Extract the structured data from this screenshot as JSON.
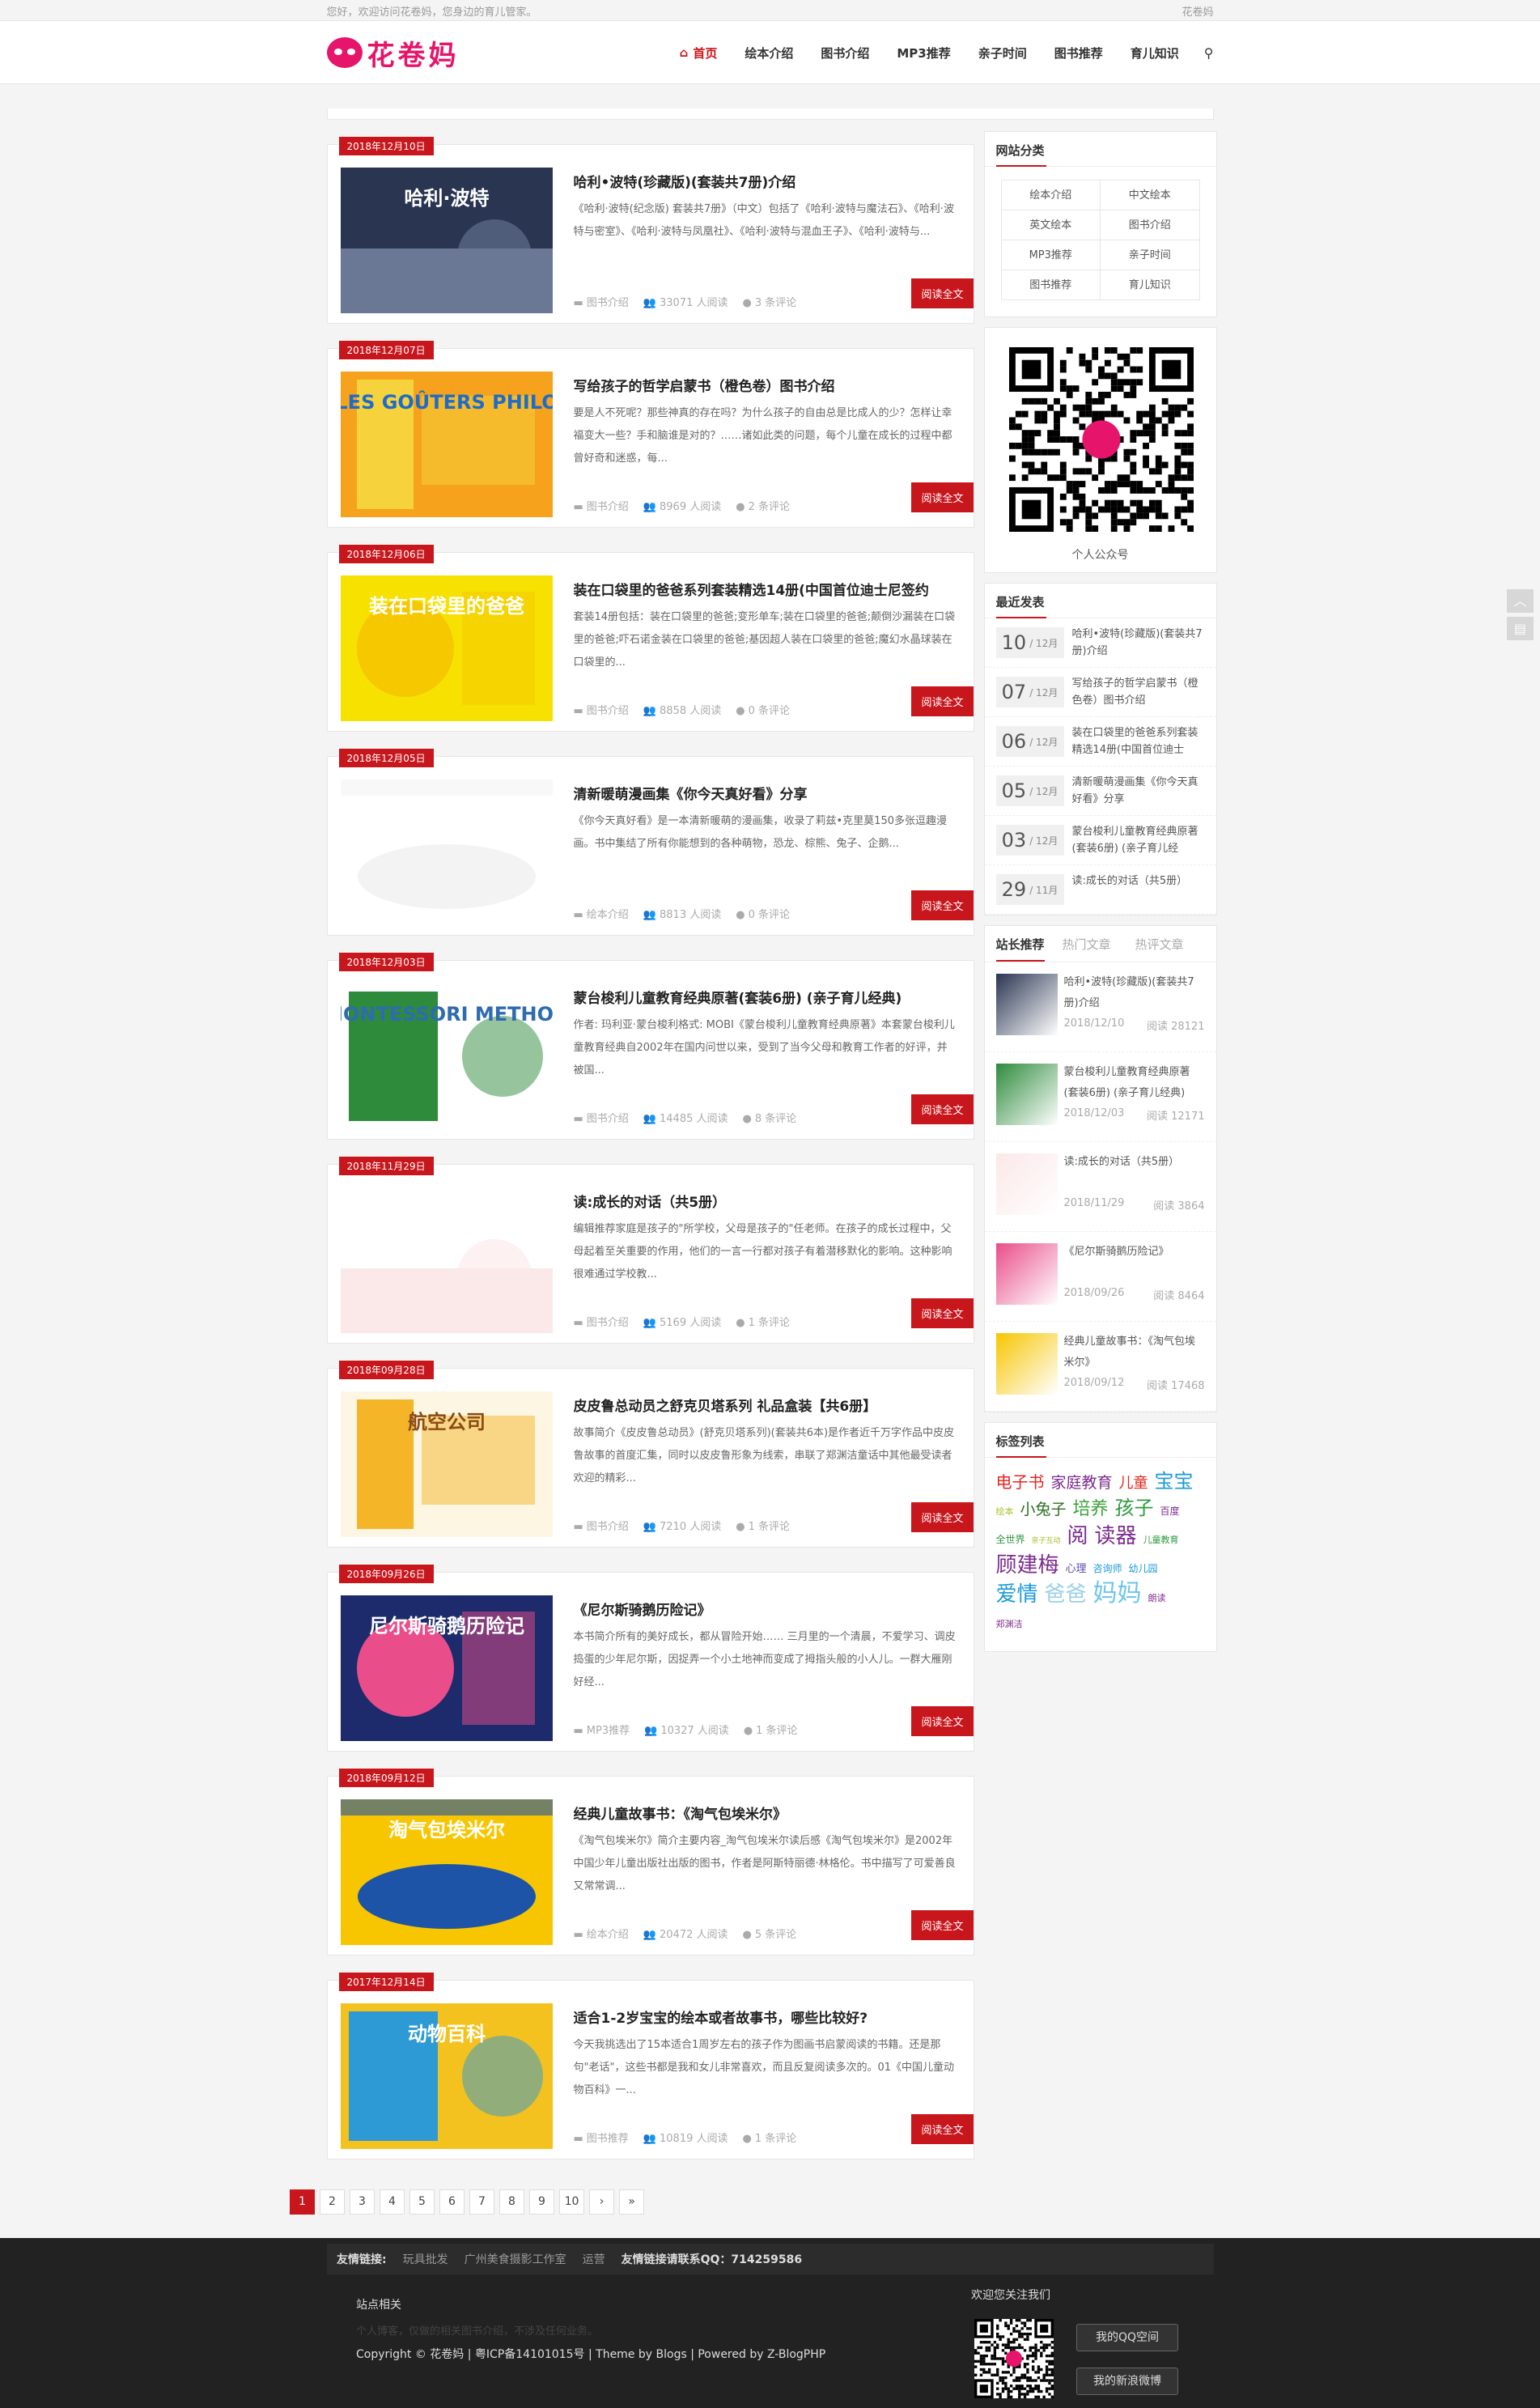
{
  "topbar": {
    "greeting": "您好，欢迎访问花卷妈，您身边的育儿管家。",
    "site": "花卷妈"
  },
  "header": {
    "logo_text": "花卷妈",
    "nav": [
      "首页",
      "绘本介绍",
      "图书介绍",
      "MP3推荐",
      "亲子时间",
      "图书推荐",
      "育儿知识"
    ]
  },
  "posts": [
    {
      "date": "2018年12月10日",
      "title": "哈利•波特(珍藏版)(套装共7册)介绍",
      "excerpt": "《哈利·波特(纪念版) 套装共7册》（中文）包括了《哈利·波特与魔法石》、《哈利·波特与密室》、《哈利·波特与凤凰社》、《哈利·波特与混血王子》、《哈利·波特与...",
      "category": "图书介绍",
      "reads": "33071 人阅读",
      "comments": "3 条评论",
      "thumb_text": "哈利·波特",
      "colors": [
        "#2a3552",
        "#6a7896"
      ]
    },
    {
      "date": "2018年12月07日",
      "title": "写给孩子的哲学启蒙书（橙色卷）图书介绍",
      "excerpt": "要是人不死呢？那些神真的存在吗？为什么孩子的自由总是比成人的少？怎样让幸福变大一些？手和脑谁是对的？……诸如此类的问题，每个儿童在成长的过程中都曾好奇和迷惑，每...",
      "category": "图书介绍",
      "reads": "8969 人阅读",
      "comments": "2 条评论",
      "thumb_text": "LES GOÛTERS PHILO",
      "colors": [
        "#f6a21c",
        "#f6d33c"
      ]
    },
    {
      "date": "2018年12月06日",
      "title": "装在口袋里的爸爸系列套装精选14册(中国首位迪士尼签约",
      "excerpt": "套装14册包括：装在口袋里的爸爸;变形单车;装在口袋里的爸爸;颠倒沙漏装在口袋里的爸爸;吓石诺金装在口袋里的爸爸;基因超人装在口袋里的爸爸;魔幻水晶球装在口袋里的...",
      "category": "图书介绍",
      "reads": "8858 人阅读",
      "comments": "0 条评论",
      "thumb_text": "装在口袋里的爸爸",
      "colors": [
        "#f7e100",
        "#f6c800"
      ]
    },
    {
      "date": "2018年12月05日",
      "title": "清新暖萌漫画集《你今天真好看》分享",
      "excerpt": "《你今天真好看》是一本清新暖萌的漫画集，收录了莉兹•克里莫150多张逗趣漫画。书中集结了所有你能想到的各种萌物，恐龙、棕熊、兔子、企鹅...",
      "category": "绘本介绍",
      "reads": "8813 人阅读",
      "comments": "0 条评论",
      "thumb_text": "",
      "colors": [
        "#ffffff",
        "#f3f3f3"
      ]
    },
    {
      "date": "2018年12月03日",
      "title": "蒙台梭利儿童教育经典原著(套装6册) (亲子育儿经典)",
      "excerpt": "作者: 玛利亚·蒙台梭利格式: MOBI《蒙台梭利儿童教育经典原著》本套蒙台梭利儿童教育经典自2002年在国内问世以来，受到了当今父母和教育工作者的好评，并被国...",
      "category": "图书介绍",
      "reads": "14485 人阅读",
      "comments": "8 条评论",
      "thumb_text": "MONTESSORI METHOD",
      "colors": [
        "#ffffff",
        "#2e8b3c"
      ]
    },
    {
      "date": "2018年11月29日",
      "title": "读:成长的对话（共5册）",
      "excerpt": "编辑推荐家庭是孩子的\"所学校，父母是孩子的\"任老师。在孩子的成长过程中，父母起着至关重要的作用，他们的一言一行都对孩子有着潜移默化的影响。这种影响很难通过学校教...",
      "category": "图书介绍",
      "reads": "5169 人阅读",
      "comments": "1 条评论",
      "thumb_text": "",
      "colors": [
        "#ffffff",
        "#fbe8e8"
      ]
    },
    {
      "date": "2018年09月28日",
      "title": "皮皮鲁总动员之舒克贝塔系列 礼品盒装【共6册】",
      "excerpt": "故事简介《皮皮鲁总动员》(舒克贝塔系列)(套装共6本)是作者近千万字作品中皮皮鲁故事的首度汇集，同时以皮皮鲁形象为线索，串联了郑渊洁童话中其他最受读者欢迎的精彩...",
      "category": "图书介绍",
      "reads": "7210 人阅读",
      "comments": "1 条评论",
      "thumb_text": "航空公司",
      "colors": [
        "#fdf6e3",
        "#f4b528"
      ]
    },
    {
      "date": "2018年09月26日",
      "title": "《尼尔斯骑鹅历险记》",
      "excerpt": "本书简介所有的美好成长，都从冒险开始…… 三月里的一个清晨，不爱学习、调皮捣蛋的少年尼尔斯，因捉弄一个小土地神而变成了拇指头般的小人儿。一群大雁刚好经...",
      "category": "MP3推荐",
      "reads": "10327 人阅读",
      "comments": "1 条评论",
      "thumb_text": "尼尔斯骑鹅历险记",
      "colors": [
        "#1d2a6b",
        "#e94d8a"
      ]
    },
    {
      "date": "2018年09月12日",
      "title": "经典儿童故事书：《淘气包埃米尔》",
      "excerpt": "《淘气包埃米尔》简介主要内容_淘气包埃米尔读后感《淘气包埃米尔》是2002年中国少年儿童出版社出版的图书，作者是阿斯特丽德·林格伦。书中描写了可爱善良又常常调...",
      "category": "绘本介绍",
      "reads": "20472 人阅读",
      "comments": "5 条评论",
      "thumb_text": "淘气包埃米尔",
      "colors": [
        "#f7c600",
        "#1d54a8"
      ]
    },
    {
      "date": "2017年12月14日",
      "title": "适合1-2岁宝宝的绘本或者故事书，哪些比较好?",
      "excerpt": "今天我挑选出了15本适合1周岁左右的孩子作为图画书启蒙阅读的书籍。还是那句\"老话\"，这些书都是我和女儿非常喜欢，而且反复阅读多次的。01《中国儿童动物百科》一...",
      "category": "图书推荐",
      "reads": "10819 人阅读",
      "comments": "1 条评论",
      "thumb_text": "动物百科",
      "colors": [
        "#f4c21e",
        "#2d9ad6"
      ]
    }
  ],
  "post_readmore": "阅读全文",
  "pagination": [
    "1",
    "2",
    "3",
    "4",
    "5",
    "6",
    "7",
    "8",
    "9",
    "10",
    "›",
    "»"
  ],
  "sidebar": {
    "categories_title": "网站分类",
    "categories": [
      "绘本介绍",
      "中文绘本",
      "英文绘本",
      "图书介绍",
      "MP3推荐",
      "亲子时间",
      "图书推荐",
      "育儿知识"
    ],
    "qr_caption": "个人公众号",
    "recent_title": "最近发表",
    "recent": [
      {
        "day": "10",
        "month": "/ 12月",
        "title": "哈利•波特(珍藏版)(套装共7册)介绍"
      },
      {
        "day": "07",
        "month": "/ 12月",
        "title": "写给孩子的哲学启蒙书（橙色卷）图书介绍"
      },
      {
        "day": "06",
        "month": "/ 12月",
        "title": "装在口袋里的爸爸系列套装精选14册(中国首位迪士"
      },
      {
        "day": "05",
        "month": "/ 12月",
        "title": "清新暖萌漫画集《你今天真好看》分享"
      },
      {
        "day": "03",
        "month": "/ 12月",
        "title": "蒙台梭利儿童教育经典原著(套装6册) (亲子育儿经"
      },
      {
        "day": "29",
        "month": "/ 11月",
        "title": "读:成长的对话（共5册）"
      }
    ],
    "tabs": [
      "站长推荐",
      "热门文章",
      "热评文章"
    ],
    "hot": [
      {
        "title": "哈利•波特(珍藏版)(套装共7册)介绍",
        "date": "2018/12/10",
        "views": "阅读 28121"
      },
      {
        "title": "蒙台梭利儿童教育经典原著(套装6册) (亲子育儿经典)",
        "date": "2018/12/03",
        "views": "阅读 12171"
      },
      {
        "title": "读:成长的对话（共5册）",
        "date": "2018/11/29",
        "views": "阅读 3864"
      },
      {
        "title": "《尼尔斯骑鹅历险记》",
        "date": "2018/09/26",
        "views": "阅读 8464"
      },
      {
        "title": "经典儿童故事书：《淘气包埃米尔》",
        "date": "2018/09/12",
        "views": "阅读 17468"
      }
    ],
    "tags_title": "标签列表",
    "tags": [
      {
        "t": "电子书",
        "c": "#e2261f",
        "s": 20
      },
      {
        "t": "家庭教育",
        "c": "#7b2b8e",
        "s": 19
      },
      {
        "t": "儿童",
        "c": "#e2261f",
        "s": 18
      },
      {
        "t": "宝宝",
        "c": "#1a9ad6",
        "s": 24
      },
      {
        "t": "绘本",
        "c": "#a6c12a",
        "s": 11
      },
      {
        "t": "小兔子",
        "c": "#2b6f1e",
        "s": 19
      },
      {
        "t": "培养",
        "c": "#3aa437",
        "s": 22
      },
      {
        "t": "孩子",
        "c": "#2b9b3c",
        "s": 24
      },
      {
        "t": "百度",
        "c": "#7b2b8e",
        "s": 12
      },
      {
        "t": "全世界",
        "c": "#2b9b3c",
        "s": 12
      },
      {
        "t": "亲子互动",
        "c": "#a6c12a",
        "s": 9
      },
      {
        "t": "阅",
        "c": "#7b2b8e",
        "s": 26
      },
      {
        "t": "读器",
        "c": "#7b2b8e",
        "s": 26
      },
      {
        "t": "儿童教育",
        "c": "#2b9b3c",
        "s": 11
      },
      {
        "t": "顾建梅",
        "c": "#7b2b8e",
        "s": 26
      },
      {
        "t": "心理",
        "c": "#5b4bb0",
        "s": 13
      },
      {
        "t": "咨询师",
        "c": "#1a9ad6",
        "s": 12
      },
      {
        "t": "幼儿园",
        "c": "#1a9ad6",
        "s": 12
      },
      {
        "t": "爱情",
        "c": "#1a9ad6",
        "s": 26
      },
      {
        "t": "爸爸",
        "c": "#9ad0e8",
        "s": 26
      },
      {
        "t": "妈妈",
        "c": "#6cc6ee",
        "s": 30
      },
      {
        "t": "朗读",
        "c": "#7b2b8e",
        "s": 11
      },
      {
        "t": "郑渊洁",
        "c": "#7b2b8e",
        "s": 11
      }
    ]
  },
  "footer": {
    "links_label": "友情链接:",
    "links": [
      "玩具批发",
      "广州美食摄影工作室",
      "运营"
    ],
    "links_contact": "友情链接请联系QQ：714259586",
    "about_title": "站点相关",
    "about_text": "个人博客，仅做的相关图书介绍，不涉及任何业务。",
    "copyright": "Copyright © 花卷妈  |  粤ICP备14101015号  |  Theme by Blogs  |  Powered by Z-BlogPHP",
    "follow_title": "欢迎您关注我们",
    "btn_qq": "我的QQ空间",
    "btn_weibo": "我的新浪微博"
  }
}
